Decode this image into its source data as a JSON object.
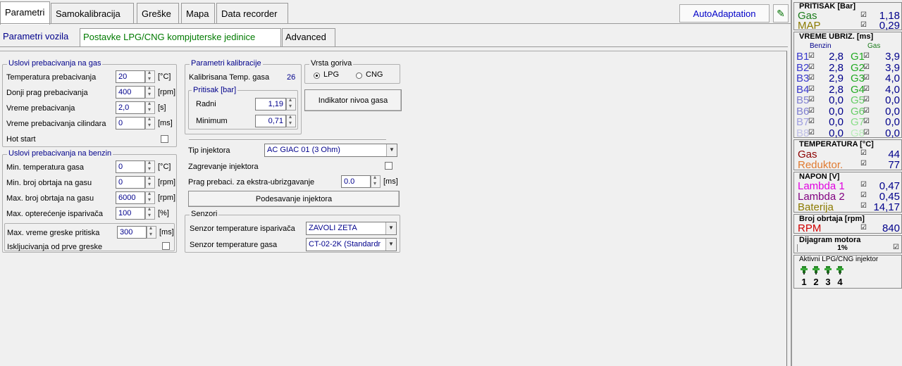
{
  "top_tabs": [
    "Parametri",
    "Samokalibracija",
    "Greške",
    "Mapa",
    "Data recorder"
  ],
  "autoadaptation_label": "AutoAdaptation",
  "sub_tabs": [
    "Parametri vozila",
    "Postavke LPG/CNG kompjuterske jedinice",
    "Advanced"
  ],
  "gas_switch": {
    "title": "Uslovi prebacivanja na gas",
    "rows": [
      {
        "label": "Temperatura prebacivanja",
        "value": "20",
        "unit": "[°C]"
      },
      {
        "label": "Donji prag prebacivanja",
        "value": "400",
        "unit": "[rpm]"
      },
      {
        "label": "Vreme prebacivanja",
        "value": "2,0",
        "unit": "[s]"
      },
      {
        "label": "Vreme prebacivanja cilindara",
        "value": "0",
        "unit": "[ms]"
      }
    ],
    "hot_start_label": "Hot start"
  },
  "petrol_switch": {
    "title": "Uslovi prebacivanja na benzin",
    "rows": [
      {
        "label": "Min. temperatura gasa",
        "value": "0",
        "unit": "[°C]"
      },
      {
        "label": "Min. broj obrtaja na gasu",
        "value": "0",
        "unit": "[rpm]"
      },
      {
        "label": "Max. broj obrtaja na gasu",
        "value": "6000",
        "unit": "[rpm]"
      },
      {
        "label": "Max. opterećenje isparivača",
        "value": "100",
        "unit": "[%]"
      }
    ],
    "max_error_time_label": "Max. vreme greske pritiska",
    "max_error_time_value": "300",
    "max_error_time_unit": "[ms]",
    "disable_first_error_label": "Iskljucivanja od prve greske"
  },
  "calibration": {
    "title": "Parametri kalibracije",
    "temp_label": "Kalibrisana Temp. gasa",
    "temp_value": "26",
    "pressure_title": "Pritisak [bar]",
    "working_label": "Radni",
    "working_value": "1,19",
    "minimum_label": "Minimum",
    "minimum_value": "0,71"
  },
  "fuel_type": {
    "title": "Vrsta goriva",
    "options": [
      "LPG",
      "CNG"
    ],
    "selected": "LPG"
  },
  "gas_level_button": "Indikator nivoa gasa",
  "injector": {
    "type_label": "Tip injektora",
    "type_value": "AC GIAC 01 (3 Ohm)",
    "heating_label": "Zagrevanje injektora",
    "threshold_label": "Prag prebaci. za ekstra-ubrizgavanje",
    "threshold_value": "0.0",
    "threshold_unit": "[ms]",
    "settings_button": "Podesavanje injektora"
  },
  "sensors": {
    "title": "Senzori",
    "evaporator_label": "Senzor temperature isparivača",
    "evaporator_value": "ZAVOLI ZETA",
    "gas_label": "Senzor temperature gasa",
    "gas_value": "CT-02-2K (Standardr"
  },
  "side": {
    "pressure": {
      "title": "PRITISAK [Bar]",
      "gas_label": "Gas",
      "gas_value": "1,18",
      "map_label": "MAP",
      "map_value": "0,29"
    },
    "inj_time": {
      "title": "VREME UBRIZ. [ms]",
      "benzin_header": "Benzin",
      "gas_header": "Gas",
      "benzin": [
        {
          "label": "B1",
          "value": "2,8"
        },
        {
          "label": "B2",
          "value": "2,8"
        },
        {
          "label": "B3",
          "value": "2,9"
        },
        {
          "label": "B4",
          "value": "2,8"
        },
        {
          "label": "B5",
          "value": "0,0"
        },
        {
          "label": "B6",
          "value": "0,0"
        },
        {
          "label": "B7",
          "value": "0,0"
        },
        {
          "label": "B8",
          "value": "0,0"
        }
      ],
      "gas": [
        {
          "label": "G1",
          "value": "3,9"
        },
        {
          "label": "G2",
          "value": "3,9"
        },
        {
          "label": "G3",
          "value": "4,0"
        },
        {
          "label": "G4",
          "value": "4,0"
        },
        {
          "label": "G5",
          "value": "0,0"
        },
        {
          "label": "G6",
          "value": "0,0"
        },
        {
          "label": "G7",
          "value": "0,0"
        },
        {
          "label": "G8",
          "value": "0,0"
        }
      ]
    },
    "temperature": {
      "title": "TEMPERATURA [°C]",
      "gas_label": "Gas",
      "gas_value": "44",
      "reducer_label": "Reduktor.",
      "reducer_value": "77"
    },
    "voltage": {
      "title": "NAPON [V]",
      "lambda1_label": "Lambda 1",
      "lambda1_value": "0,47",
      "lambda2_label": "Lambda 2",
      "lambda2_value": "0,45",
      "battery_label": "Baterija",
      "battery_value": "14,17"
    },
    "rpm": {
      "title": "Broj obrtaja [rpm]",
      "label": "RPM",
      "value": "840"
    },
    "engine_diagram": {
      "title": "Dijagram motora",
      "value": "1%"
    },
    "active_injectors": {
      "title": "Aktivni LPG/CNG injektor",
      "numbers": [
        "1",
        "2",
        "3",
        "4"
      ]
    }
  },
  "colors": {
    "blue_text": "#00008b",
    "green_text": "#007a00",
    "gas_green": "#1a7a1a",
    "map_olive": "#8b7a00",
    "benzin_blue": "#3a3acc",
    "gas_light_green": "#22cc22",
    "red": "#d00000",
    "orange": "#e07a30",
    "magenta": "#e000e0",
    "purple": "#800080"
  }
}
